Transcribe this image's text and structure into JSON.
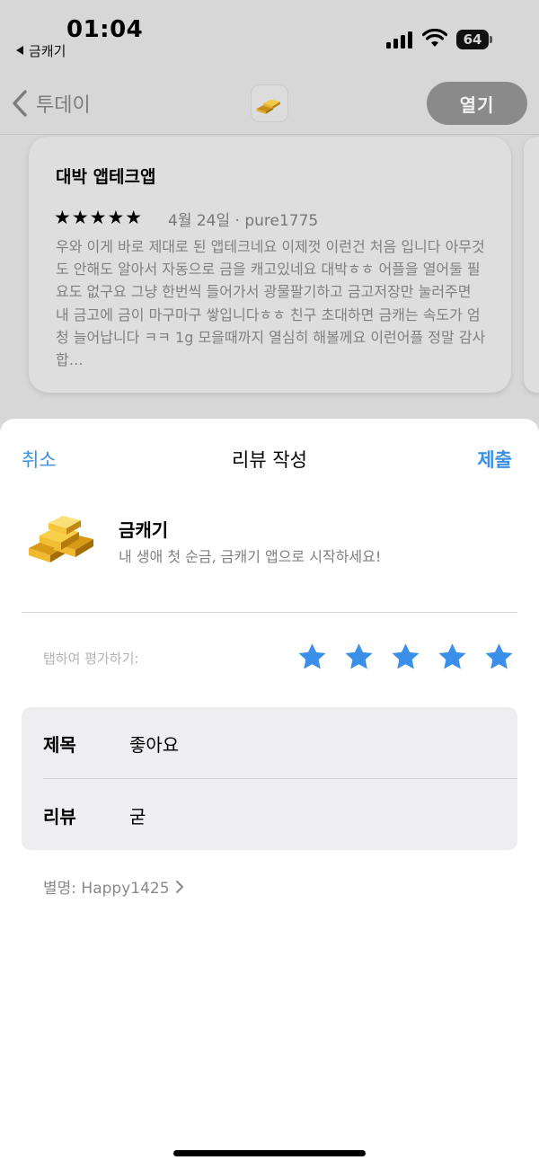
{
  "status_bar": {
    "time": "01:04",
    "back_app": "금캐기",
    "battery": "64",
    "icons": [
      "signal-icon",
      "wifi-icon",
      "battery-icon"
    ]
  },
  "nav": {
    "back_label": "투데이",
    "open_label": "열기",
    "icon": "gold-bars-icon"
  },
  "review_card": {
    "title": "대박 앱테크앱",
    "stars": "★★★★★",
    "rating": 5,
    "meta": "4월 24일 · pure1775",
    "body": "우와 이게 바로 제대로 된 앱테크네요 이제껏 이런건 처음 입니다 아무것도 안해도 알아서 자동으로 금을 캐고있네요 대박ㅎㅎ 어플을 열어둘 필요도 없구요 그냥 한번씩 들어가서 광물팔기하고 금고저장만 눌러주면 내 금고에 금이 마구마구 쌓입니다ㅎㅎ 친구 초대하면 금캐는 속도가 엄청 늘어납니다 ㅋㅋ 1g 모을때까지 열심히 해볼께요 이런어플 정말 감사합…"
  },
  "sheet": {
    "cancel_label": "취소",
    "title": "리뷰 작성",
    "submit_label": "제출",
    "app": {
      "name": "금캐기",
      "subtitle": "내 생애 첫 순금, 금캐기 앱으로 시작하세요!"
    },
    "rate_label": "탭하여 평가하기:",
    "selected_rating": 5,
    "form": {
      "title_label": "제목",
      "title_value": "좋아요",
      "review_label": "리뷰",
      "review_value": "굳"
    },
    "nickname": "별명: Happy1425"
  },
  "colors": {
    "accent": "#3a8fe8",
    "star": "#3a8fe8"
  }
}
